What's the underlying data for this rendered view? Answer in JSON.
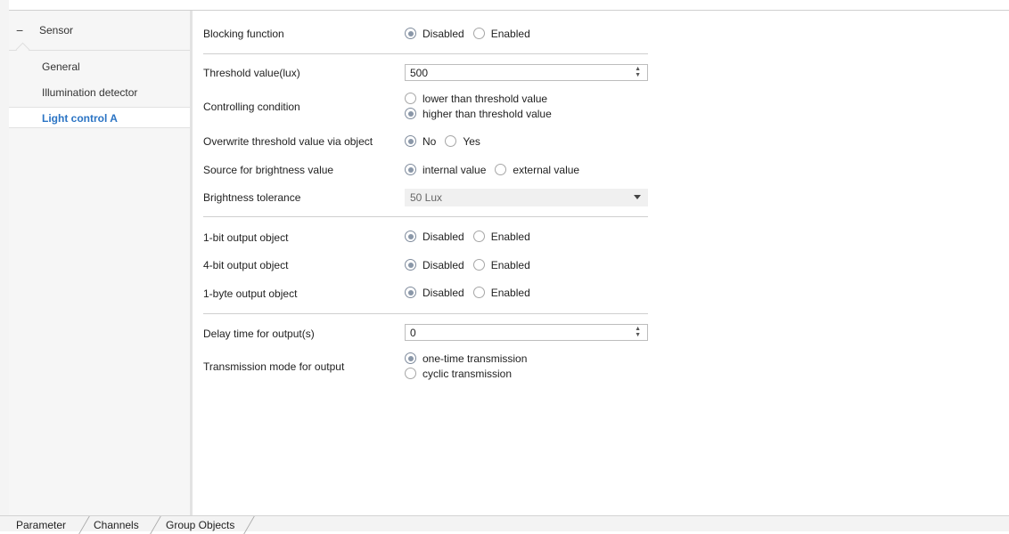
{
  "sidebar": {
    "header": "Sensor",
    "items": [
      {
        "label": "General"
      },
      {
        "label": "Illumination detector"
      },
      {
        "label": "Light control A"
      }
    ]
  },
  "params": {
    "blocking_function": {
      "label": "Blocking function",
      "options": [
        "Disabled",
        "Enabled"
      ],
      "selected": "Disabled"
    },
    "threshold_value": {
      "label": "Threshold value(lux)",
      "value": "500"
    },
    "controlling_condition": {
      "label": "Controlling condition",
      "options": [
        "lower than threshold value",
        "higher than threshold value"
      ],
      "selected": "higher than threshold value"
    },
    "overwrite_threshold": {
      "label": "Overwrite threshold value via object",
      "options": [
        "No",
        "Yes"
      ],
      "selected": "No"
    },
    "source_brightness": {
      "label": "Source for brightness value",
      "options": [
        "internal value",
        "external value"
      ],
      "selected": "internal value"
    },
    "brightness_tolerance": {
      "label": "Brightness tolerance",
      "value": "50 Lux"
    },
    "output_1bit": {
      "label": "1-bit output object",
      "options": [
        "Disabled",
        "Enabled"
      ],
      "selected": "Disabled"
    },
    "output_4bit": {
      "label": "4-bit output object",
      "options": [
        "Disabled",
        "Enabled"
      ],
      "selected": "Disabled"
    },
    "output_1byte": {
      "label": "1-byte output object",
      "options": [
        "Disabled",
        "Enabled"
      ],
      "selected": "Disabled"
    },
    "delay_time": {
      "label": "Delay time for output(s)",
      "value": "0"
    },
    "transmission_mode": {
      "label": "Transmission mode for output",
      "options": [
        "one-time transmission",
        "cyclic transmission"
      ],
      "selected": "one-time transmission"
    }
  },
  "tabs": [
    {
      "label": "Parameter"
    },
    {
      "label": "Channels"
    },
    {
      "label": "Group Objects"
    }
  ],
  "colors": {
    "accent": "#2b74c4"
  }
}
